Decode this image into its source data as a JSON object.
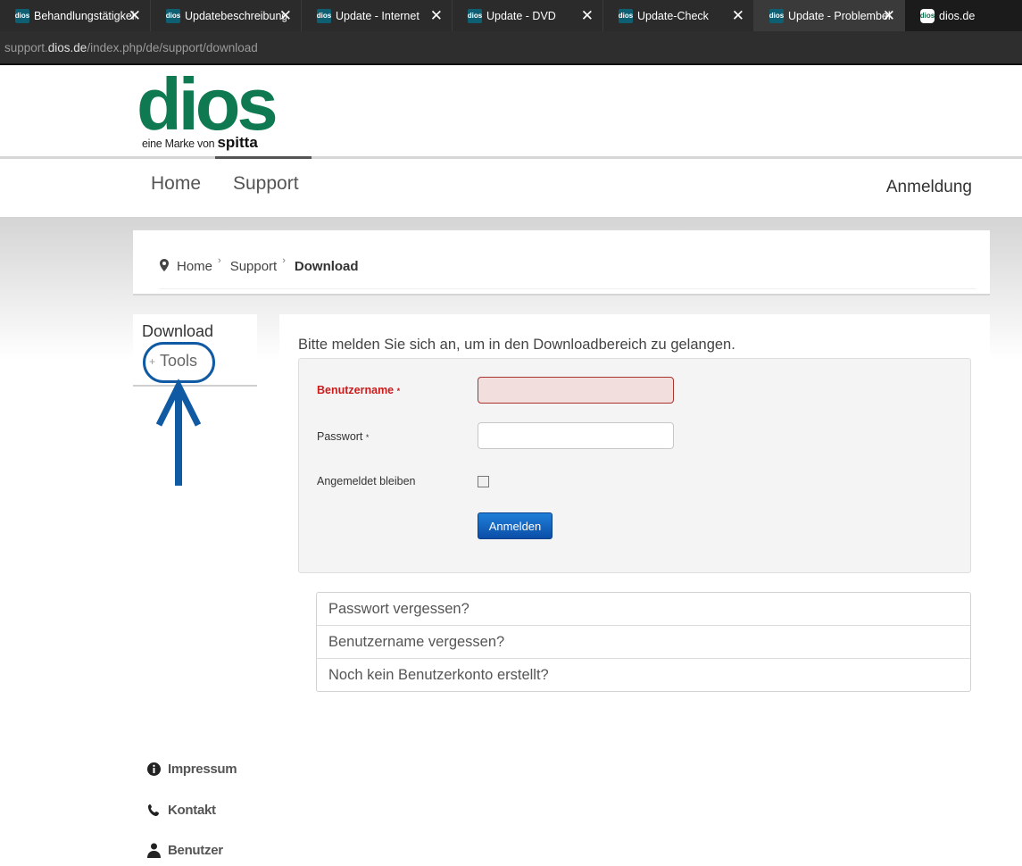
{
  "browser": {
    "tabs": [
      {
        "favicon": "dios",
        "title": "Behandlungstätigkeit"
      },
      {
        "favicon": "dios",
        "title": "Updatebeschreibung"
      },
      {
        "favicon": "dios",
        "title": "Update - Internet"
      },
      {
        "favicon": "dios",
        "title": "Update - DVD"
      },
      {
        "favicon": "dios",
        "title": "Update-Check"
      },
      {
        "favicon": "dios",
        "title": "Update - Problembehandlung"
      },
      {
        "favicon": "dios",
        "title": "dios.de"
      }
    ],
    "address": {
      "prefix": "support.",
      "host": "dios.de",
      "path": "/index.php/de/support/download"
    }
  },
  "header": {
    "logo_text": "dios",
    "logo_sub_prefix": "eine Marke von",
    "logo_sub_brand": "spitta",
    "nav": {
      "home": "Home",
      "support": "Support",
      "login": "Anmeldung"
    }
  },
  "breadcrumb": {
    "items": [
      "Home",
      "Support"
    ],
    "current": "Download"
  },
  "sidebar": {
    "title": "Download",
    "items": [
      "Tools"
    ]
  },
  "login": {
    "intro": "Bitte melden Sie sich an, um in den Downloadbereich zu gelangen.",
    "username_label": "Benutzername",
    "password_label": "Passwort",
    "required_marker": "*",
    "username_value": "",
    "password_value": "",
    "remember_label": "Angemeldet bleiben",
    "submit_label": "Anmelden"
  },
  "links": [
    "Passwort vergessen?",
    "Benutzername vergessen?",
    "Noch kein Benutzerkonto erstellt?"
  ],
  "footer": {
    "items": [
      "Impressum",
      "Kontakt",
      "Benutzer"
    ]
  },
  "colors": {
    "brand_green": "#0f7a52",
    "annotation_blue": "#0f5aa3",
    "error_red": "#cc1b1b",
    "button_blue": "#1f7fd8"
  }
}
